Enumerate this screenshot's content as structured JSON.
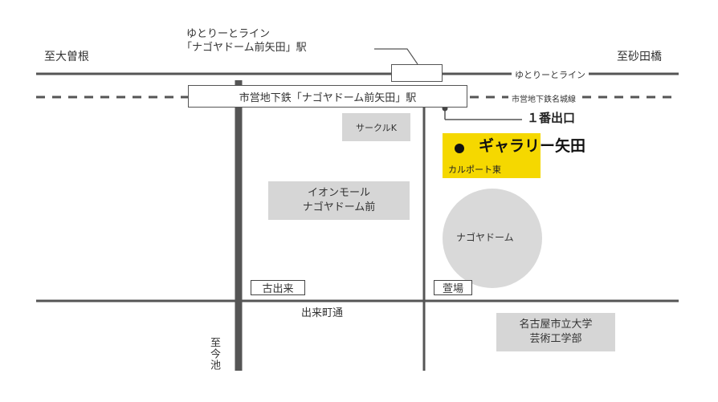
{
  "directions": {
    "left": "至大曽根",
    "right": "至砂田橋",
    "bottom": "至今池"
  },
  "yutorie_station": {
    "line1": "ゆとりーとライン",
    "line2": "「ナゴヤドーム前矢田」駅"
  },
  "lines": {
    "yutorie": "ゆとりーとライン",
    "subway": "市営地下鉄名城線"
  },
  "subway_station": "市営地下鉄「ナゴヤドーム前矢田」駅",
  "exit_label": "１番出口",
  "gallery": {
    "name": "ギャラリー矢田",
    "building": "カルポート東",
    "highlight_color": "#f5d800"
  },
  "landmarks": {
    "circle_k": "サークルK",
    "aeon_line1": "イオンモール",
    "aeon_line2": "ナゴヤドーム前",
    "dome": "ナゴヤドーム",
    "univ_line1": "名古屋市立大学",
    "univ_line2": "芸術工学部"
  },
  "intersections": {
    "furuideki": "古出来",
    "kayaba": "萱場"
  },
  "street": "出来町通",
  "colors": {
    "road": "#555555",
    "landmark_bg": "#d6d6d6",
    "dome_bg": "#d9d9d9"
  }
}
